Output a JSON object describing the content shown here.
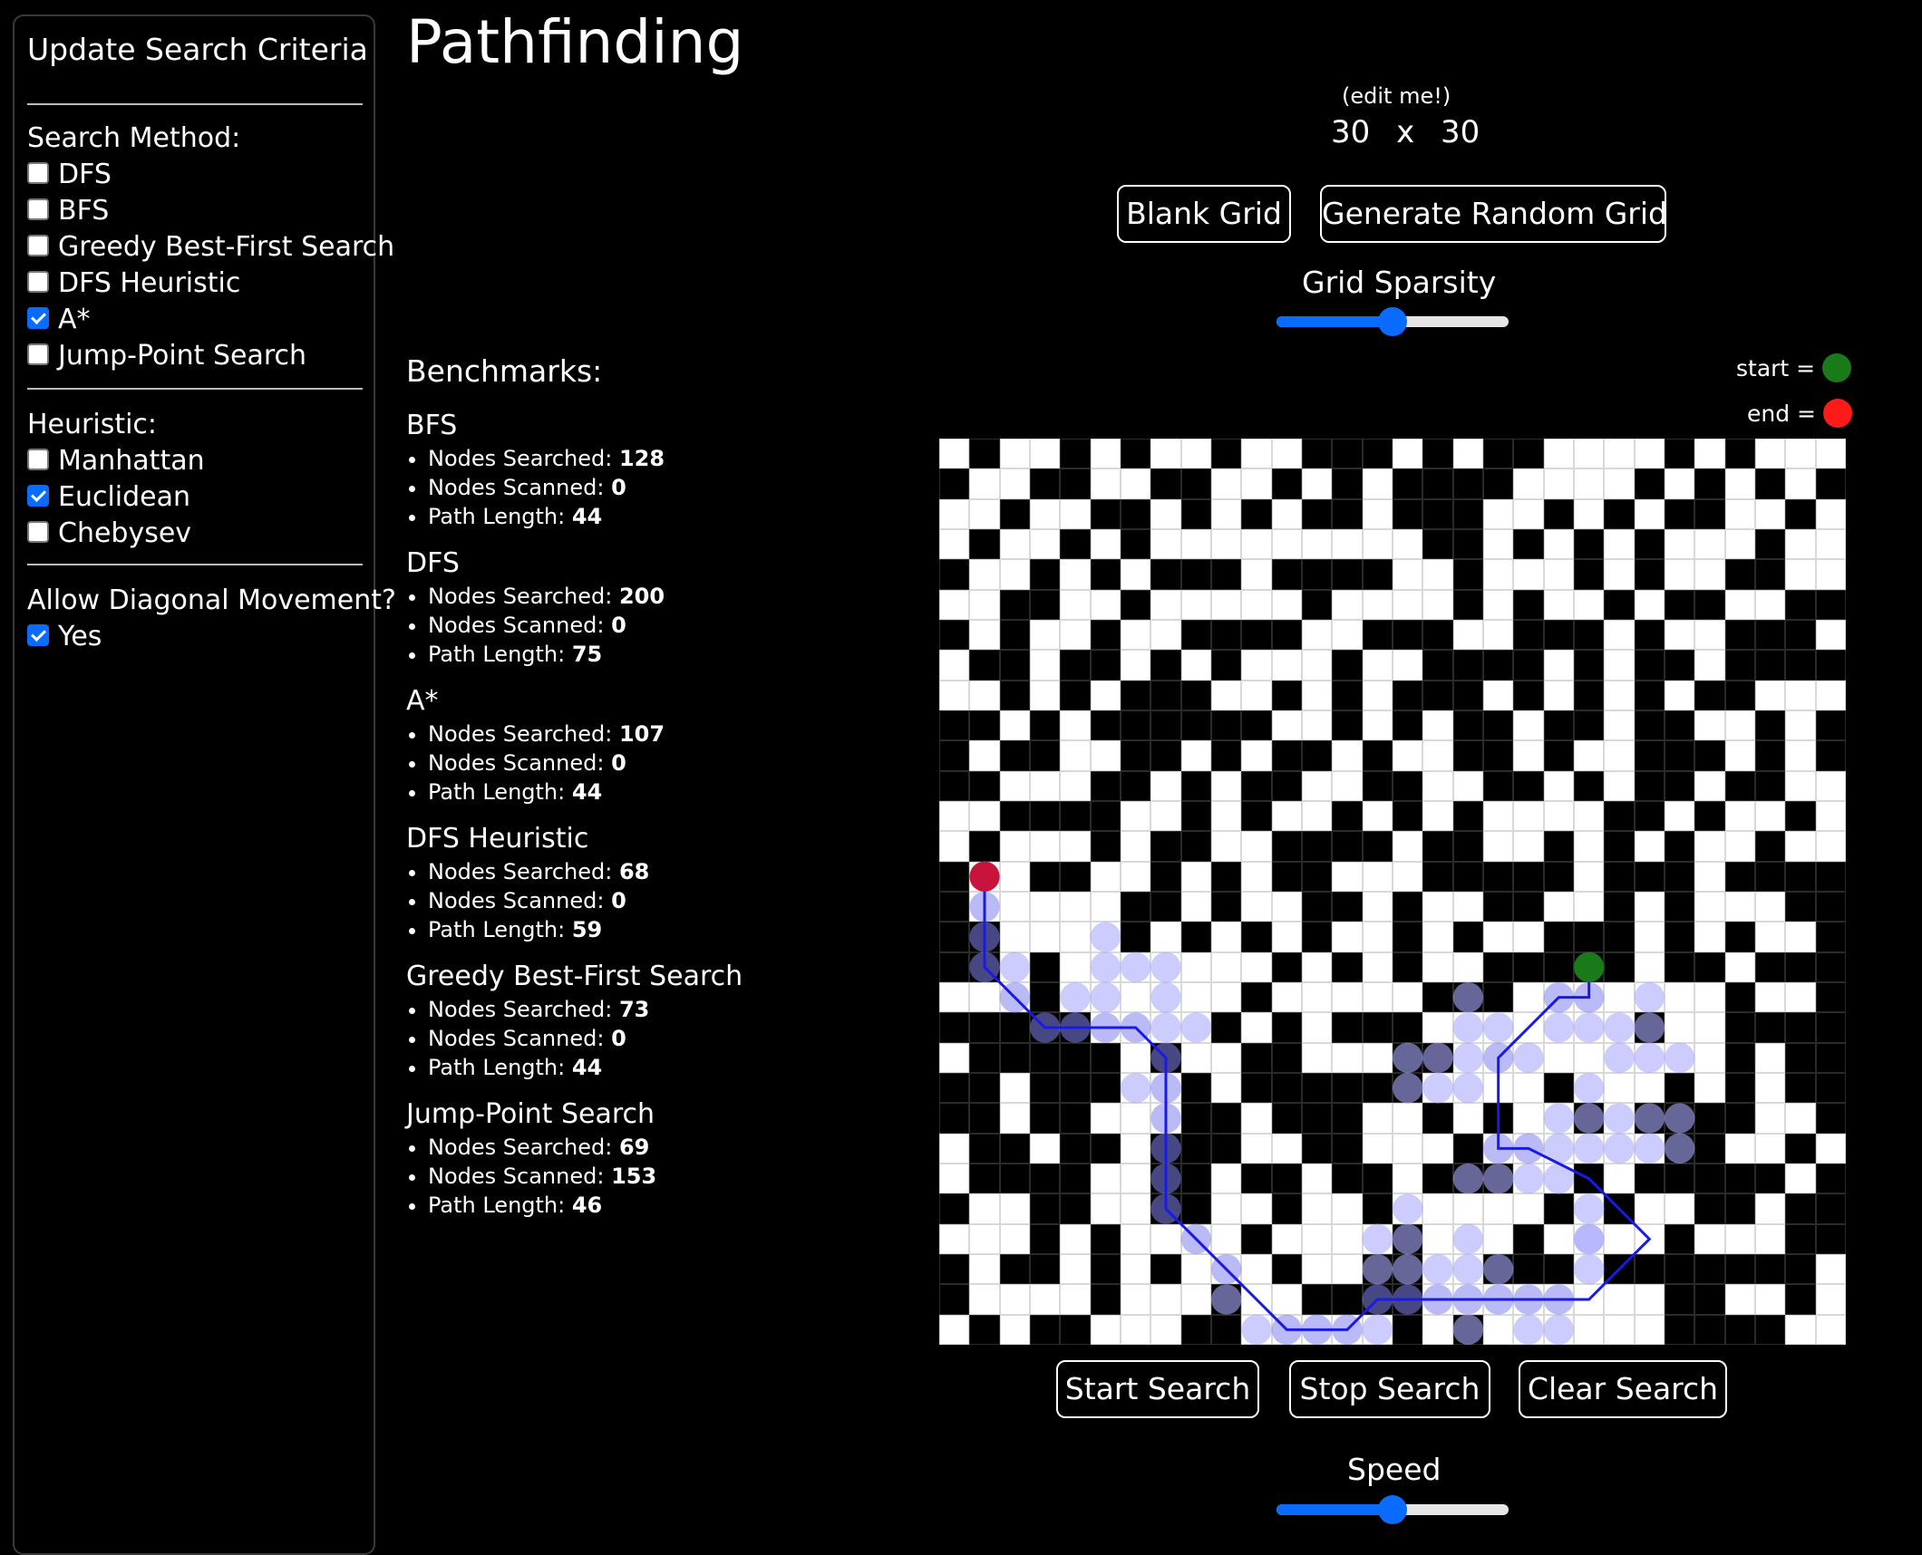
{
  "sidebar": {
    "title": "Update Search Criteria",
    "search_method_label": "Search Method:",
    "methods": [
      {
        "label": "DFS",
        "checked": false
      },
      {
        "label": "BFS",
        "checked": false
      },
      {
        "label": "Greedy Best-First Search",
        "checked": false
      },
      {
        "label": "DFS Heuristic",
        "checked": false
      },
      {
        "label": "A*",
        "checked": true
      },
      {
        "label": "Jump-Point Search",
        "checked": false
      }
    ],
    "heuristic_label": "Heuristic:",
    "heuristics": [
      {
        "label": "Manhattan",
        "checked": false
      },
      {
        "label": "Euclidean",
        "checked": true
      },
      {
        "label": "Chebysev",
        "checked": false
      }
    ],
    "diagonal_label": "Allow Diagonal Movement?",
    "diagonal": {
      "label": "Yes",
      "checked": true
    }
  },
  "header": {
    "title": "Pathfinding",
    "edit_hint": "(edit me!)",
    "rows": "30",
    "cols": "30",
    "times": "x"
  },
  "buttons": {
    "blank_grid": "Blank Grid",
    "random_grid": "Generate Random Grid",
    "start": "Start Search",
    "stop": "Stop Search",
    "clear": "Clear Search"
  },
  "sliders": {
    "sparsity_label": "Grid Sparsity",
    "sparsity_value": 0.5,
    "speed_label": "Speed",
    "speed_value": 0.5
  },
  "legend": {
    "start_label": "start =",
    "end_label": "end =",
    "start_color": "#1a7a1a",
    "end_color": "#ff1a1a"
  },
  "benchmarks": {
    "title": "Benchmarks:",
    "searched_label": "Nodes Searched:",
    "scanned_label": "Nodes Scanned:",
    "length_label": "Path Length:",
    "items": [
      {
        "name": "BFS",
        "searched": "128",
        "scanned": "0",
        "length": "44"
      },
      {
        "name": "DFS",
        "searched": "200",
        "scanned": "0",
        "length": "75"
      },
      {
        "name": "A*",
        "searched": "107",
        "scanned": "0",
        "length": "44"
      },
      {
        "name": "DFS Heuristic",
        "searched": "68",
        "scanned": "0",
        "length": "59"
      },
      {
        "name": "Greedy Best-First Search",
        "searched": "73",
        "scanned": "0",
        "length": "44"
      },
      {
        "name": "Jump-Point Search",
        "searched": "69",
        "scanned": "153",
        "length": "46"
      }
    ]
  },
  "grid": {
    "size": 30,
    "start": [
      17,
      21
    ],
    "end": [
      14,
      1
    ],
    "walls": [
      [
        0,
        1,
        0,
        0,
        1,
        0,
        1,
        0,
        0,
        1,
        0,
        0,
        1,
        1,
        1,
        0,
        1,
        0,
        1,
        1,
        0,
        0,
        0,
        0,
        1,
        0,
        1,
        0,
        0,
        0
      ],
      [
        1,
        0,
        0,
        1,
        1,
        0,
        0,
        1,
        1,
        0,
        0,
        1,
        0,
        1,
        0,
        1,
        1,
        1,
        1,
        0,
        0,
        0,
        0,
        1,
        0,
        1,
        0,
        1,
        0,
        1
      ],
      [
        0,
        0,
        1,
        0,
        0,
        1,
        1,
        0,
        1,
        0,
        1,
        0,
        1,
        1,
        0,
        1,
        1,
        1,
        0,
        0,
        1,
        0,
        1,
        0,
        1,
        1,
        0,
        0,
        1,
        0
      ],
      [
        0,
        1,
        0,
        0,
        1,
        0,
        1,
        0,
        0,
        0,
        0,
        0,
        0,
        0,
        0,
        0,
        1,
        1,
        0,
        1,
        0,
        1,
        0,
        1,
        0,
        0,
        0,
        1,
        0,
        0
      ],
      [
        1,
        0,
        0,
        1,
        0,
        1,
        0,
        1,
        1,
        1,
        0,
        1,
        1,
        1,
        1,
        0,
        0,
        1,
        0,
        0,
        0,
        1,
        0,
        1,
        0,
        0,
        1,
        1,
        0,
        0
      ],
      [
        0,
        0,
        1,
        1,
        0,
        0,
        1,
        0,
        0,
        0,
        0,
        0,
        1,
        0,
        0,
        0,
        0,
        1,
        0,
        1,
        0,
        0,
        1,
        0,
        1,
        1,
        0,
        0,
        1,
        1
      ],
      [
        1,
        0,
        1,
        0,
        0,
        1,
        0,
        0,
        1,
        1,
        1,
        1,
        0,
        0,
        1,
        1,
        1,
        0,
        0,
        1,
        1,
        1,
        0,
        1,
        0,
        0,
        1,
        1,
        1,
        0
      ],
      [
        0,
        1,
        1,
        0,
        1,
        1,
        0,
        1,
        0,
        1,
        0,
        0,
        0,
        1,
        0,
        0,
        1,
        1,
        1,
        1,
        0,
        1,
        0,
        1,
        1,
        0,
        1,
        1,
        1,
        1
      ],
      [
        0,
        0,
        1,
        0,
        1,
        0,
        1,
        1,
        1,
        0,
        0,
        1,
        0,
        1,
        0,
        1,
        1,
        1,
        0,
        1,
        0,
        1,
        0,
        1,
        0,
        1,
        1,
        0,
        0,
        0
      ],
      [
        1,
        1,
        0,
        1,
        0,
        1,
        1,
        1,
        1,
        1,
        1,
        0,
        0,
        1,
        0,
        1,
        0,
        1,
        1,
        0,
        1,
        1,
        0,
        1,
        1,
        0,
        0,
        1,
        0,
        1
      ],
      [
        1,
        0,
        1,
        1,
        0,
        0,
        1,
        1,
        0,
        1,
        0,
        1,
        1,
        0,
        1,
        0,
        0,
        1,
        1,
        0,
        1,
        0,
        0,
        1,
        1,
        1,
        0,
        1,
        0,
        1
      ],
      [
        1,
        1,
        0,
        0,
        0,
        1,
        1,
        0,
        1,
        0,
        1,
        1,
        0,
        0,
        1,
        1,
        0,
        0,
        1,
        1,
        0,
        1,
        0,
        1,
        1,
        0,
        1,
        1,
        0,
        0
      ],
      [
        0,
        0,
        1,
        1,
        1,
        1,
        0,
        0,
        1,
        0,
        1,
        0,
        0,
        1,
        0,
        1,
        0,
        1,
        0,
        0,
        0,
        0,
        1,
        1,
        0,
        1,
        0,
        0,
        1,
        0
      ],
      [
        0,
        1,
        0,
        0,
        0,
        1,
        0,
        1,
        1,
        0,
        0,
        1,
        1,
        1,
        1,
        0,
        1,
        1,
        0,
        0,
        1,
        0,
        1,
        0,
        1,
        0,
        0,
        1,
        0,
        0
      ],
      [
        1,
        0,
        0,
        1,
        1,
        0,
        0,
        1,
        0,
        1,
        0,
        1,
        1,
        0,
        0,
        0,
        1,
        1,
        1,
        1,
        1,
        0,
        1,
        1,
        1,
        0,
        1,
        1,
        1,
        1
      ],
      [
        1,
        0,
        0,
        0,
        0,
        0,
        1,
        1,
        0,
        1,
        0,
        0,
        1,
        1,
        0,
        1,
        0,
        0,
        1,
        1,
        0,
        0,
        1,
        0,
        1,
        0,
        0,
        0,
        1,
        1
      ],
      [
        1,
        1,
        0,
        0,
        0,
        0,
        1,
        0,
        1,
        0,
        1,
        0,
        1,
        0,
        0,
        1,
        0,
        1,
        0,
        0,
        1,
        1,
        1,
        0,
        1,
        0,
        1,
        0,
        0,
        1
      ],
      [
        1,
        1,
        0,
        1,
        0,
        0,
        0,
        0,
        0,
        0,
        0,
        1,
        0,
        1,
        0,
        1,
        0,
        0,
        1,
        1,
        1,
        1,
        1,
        0,
        1,
        1,
        0,
        1,
        1,
        1
      ],
      [
        0,
        0,
        0,
        1,
        0,
        0,
        0,
        0,
        0,
        0,
        1,
        0,
        0,
        0,
        0,
        0,
        1,
        1,
        1,
        0,
        0,
        0,
        0,
        0,
        0,
        0,
        1,
        0,
        0,
        1
      ],
      [
        1,
        1,
        1,
        1,
        1,
        0,
        0,
        0,
        0,
        1,
        0,
        1,
        0,
        1,
        1,
        1,
        0,
        0,
        0,
        0,
        0,
        0,
        0,
        1,
        0,
        0,
        1,
        1,
        1,
        1
      ],
      [
        0,
        1,
        1,
        1,
        1,
        1,
        0,
        1,
        0,
        0,
        1,
        1,
        0,
        0,
        0,
        1,
        1,
        0,
        0,
        0,
        0,
        0,
        0,
        0,
        0,
        0,
        1,
        0,
        1,
        1
      ],
      [
        1,
        1,
        0,
        1,
        1,
        1,
        0,
        0,
        1,
        0,
        1,
        1,
        1,
        1,
        1,
        1,
        0,
        0,
        0,
        0,
        1,
        0,
        0,
        0,
        1,
        0,
        1,
        0,
        1,
        1
      ],
      [
        1,
        1,
        0,
        1,
        1,
        0,
        0,
        0,
        1,
        1,
        0,
        1,
        1,
        1,
        0,
        0,
        1,
        0,
        1,
        0,
        0,
        1,
        0,
        1,
        1,
        1,
        1,
        0,
        0,
        1
      ],
      [
        0,
        1,
        1,
        0,
        1,
        1,
        0,
        1,
        1,
        1,
        0,
        0,
        1,
        1,
        0,
        0,
        0,
        1,
        0,
        0,
        0,
        0,
        0,
        0,
        1,
        1,
        0,
        0,
        1,
        0
      ],
      [
        0,
        1,
        1,
        1,
        1,
        0,
        0,
        1,
        1,
        0,
        1,
        1,
        0,
        1,
        1,
        0,
        1,
        1,
        1,
        0,
        0,
        1,
        0,
        1,
        1,
        1,
        1,
        1,
        0,
        1
      ],
      [
        1,
        0,
        0,
        1,
        1,
        0,
        0,
        1,
        1,
        0,
        0,
        1,
        0,
        0,
        1,
        0,
        0,
        0,
        0,
        0,
        1,
        0,
        1,
        0,
        0,
        1,
        1,
        0,
        1,
        1
      ],
      [
        0,
        0,
        0,
        1,
        0,
        1,
        0,
        0,
        0,
        0,
        1,
        0,
        0,
        0,
        0,
        1,
        0,
        0,
        0,
        1,
        0,
        0,
        0,
        0,
        1,
        0,
        0,
        0,
        1,
        1
      ],
      [
        1,
        0,
        1,
        1,
        0,
        1,
        0,
        1,
        0,
        0,
        0,
        1,
        0,
        0,
        1,
        1,
        0,
        0,
        1,
        1,
        1,
        0,
        1,
        1,
        1,
        1,
        1,
        1,
        1,
        0
      ],
      [
        1,
        0,
        0,
        0,
        0,
        1,
        0,
        0,
        0,
        1,
        0,
        0,
        1,
        1,
        1,
        1,
        0,
        0,
        0,
        0,
        0,
        0,
        0,
        0,
        1,
        1,
        0,
        0,
        1,
        0
      ],
      [
        0,
        1,
        0,
        1,
        1,
        0,
        0,
        0,
        1,
        1,
        0,
        0,
        0,
        0,
        0,
        1,
        0,
        1,
        0,
        0,
        0,
        0,
        0,
        0,
        1,
        1,
        1,
        1,
        0,
        0
      ]
    ],
    "visited": [
      [
        15,
        1
      ],
      [
        16,
        1
      ],
      [
        17,
        1
      ],
      [
        17,
        2
      ],
      [
        16,
        5
      ],
      [
        17,
        5
      ],
      [
        17,
        6
      ],
      [
        17,
        7
      ],
      [
        18,
        2
      ],
      [
        18,
        4
      ],
      [
        18,
        5
      ],
      [
        18,
        7
      ],
      [
        19,
        3
      ],
      [
        19,
        4
      ],
      [
        19,
        5
      ],
      [
        19,
        6
      ],
      [
        19,
        7
      ],
      [
        19,
        8
      ],
      [
        20,
        7
      ],
      [
        21,
        6
      ],
      [
        21,
        7
      ],
      [
        22,
        7
      ],
      [
        23,
        7
      ],
      [
        24,
        7
      ],
      [
        25,
        7
      ],
      [
        26,
        8
      ],
      [
        27,
        9
      ],
      [
        28,
        9
      ],
      [
        29,
        10
      ],
      [
        29,
        11
      ],
      [
        29,
        12
      ],
      [
        29,
        13
      ],
      [
        29,
        14
      ],
      [
        28,
        14
      ],
      [
        27,
        14
      ],
      [
        26,
        14
      ],
      [
        27,
        15
      ],
      [
        28,
        15
      ],
      [
        28,
        16
      ],
      [
        28,
        17
      ],
      [
        28,
        18
      ],
      [
        28,
        19
      ],
      [
        28,
        20
      ],
      [
        29,
        17
      ],
      [
        29,
        19
      ],
      [
        29,
        20
      ],
      [
        26,
        17
      ],
      [
        27,
        17
      ],
      [
        27,
        18
      ],
      [
        27,
        21
      ],
      [
        26,
        21
      ],
      [
        25,
        21
      ],
      [
        24,
        20
      ],
      [
        24,
        19
      ],
      [
        24,
        18
      ],
      [
        24,
        17
      ],
      [
        23,
        18
      ],
      [
        23,
        19
      ],
      [
        23,
        20
      ],
      [
        23,
        21
      ],
      [
        23,
        22
      ],
      [
        22,
        20
      ],
      [
        22,
        21
      ],
      [
        22,
        22
      ],
      [
        21,
        17
      ],
      [
        21,
        16
      ],
      [
        20,
        16
      ],
      [
        20,
        17
      ],
      [
        20,
        18
      ],
      [
        20,
        19
      ],
      [
        19,
        17
      ],
      [
        19,
        18
      ],
      [
        19,
        20
      ],
      [
        18,
        20
      ],
      [
        18,
        21
      ],
      [
        18,
        17
      ],
      [
        18,
        23
      ],
      [
        19,
        21
      ],
      [
        19,
        22
      ],
      [
        19,
        23
      ],
      [
        20,
        22
      ],
      [
        20,
        23
      ],
      [
        20,
        24
      ],
      [
        21,
        21
      ],
      [
        22,
        23
      ],
      [
        23,
        23
      ],
      [
        23,
        24
      ],
      [
        22,
        24
      ],
      [
        20,
        15
      ],
      [
        21,
        15
      ],
      [
        26,
        21
      ],
      [
        27,
        16
      ],
      [
        26,
        15
      ],
      [
        25,
        15
      ]
    ],
    "path": [
      [
        14,
        1
      ],
      [
        15,
        1
      ],
      [
        16,
        1
      ],
      [
        17,
        1
      ],
      [
        18,
        2
      ],
      [
        19,
        3
      ],
      [
        19,
        4
      ],
      [
        19,
        5
      ],
      [
        19,
        6
      ],
      [
        20,
        7
      ],
      [
        21,
        7
      ],
      [
        22,
        7
      ],
      [
        23,
        7
      ],
      [
        24,
        7
      ],
      [
        25,
        7
      ],
      [
        26,
        8
      ],
      [
        27,
        9
      ],
      [
        28,
        10
      ],
      [
        29,
        11
      ],
      [
        29,
        12
      ],
      [
        29,
        13
      ],
      [
        28,
        14
      ],
      [
        28,
        15
      ],
      [
        28,
        16
      ],
      [
        28,
        17
      ],
      [
        28,
        18
      ],
      [
        28,
        19
      ],
      [
        28,
        20
      ],
      [
        28,
        21
      ],
      [
        27,
        22
      ],
      [
        26,
        23
      ],
      [
        25,
        22
      ],
      [
        24,
        21
      ],
      [
        23,
        19
      ],
      [
        23,
        18
      ],
      [
        22,
        18
      ],
      [
        21,
        18
      ],
      [
        20,
        18
      ],
      [
        19,
        19
      ],
      [
        18,
        20
      ],
      [
        18,
        21
      ],
      [
        17,
        21
      ]
    ]
  }
}
